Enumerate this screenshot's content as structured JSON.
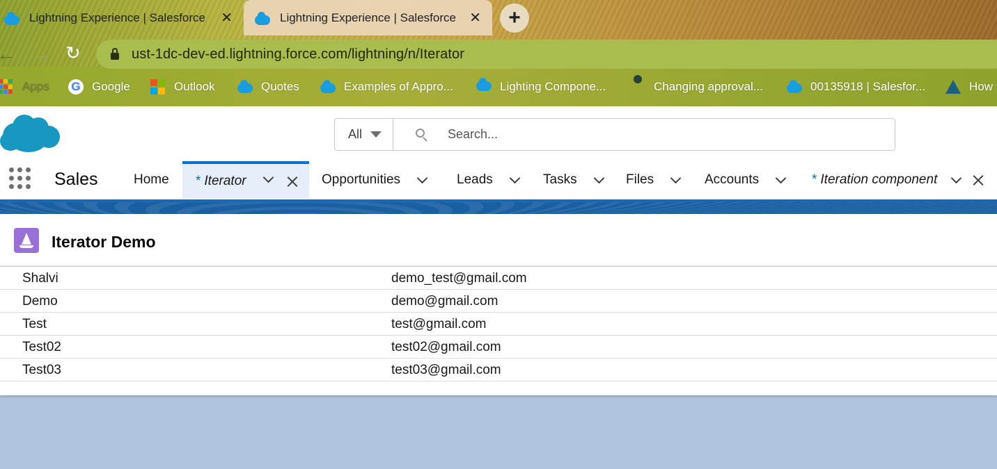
{
  "browser": {
    "tabs": [
      {
        "title": "Lightning Experience | Salesforce",
        "close": "✕"
      },
      {
        "title": "Lightning Experience | Salesforce",
        "close": "✕"
      }
    ],
    "new_tab": "+",
    "url": "ust-1dc-dev-ed.lightning.force.com/lightning/n/Iterator",
    "bookmarks": [
      {
        "label": "Apps",
        "icon": "apps-grid-icon"
      },
      {
        "label": "Google",
        "icon": "google-icon"
      },
      {
        "label": "Outlook",
        "icon": "microsoft-icon"
      },
      {
        "label": "Quotes",
        "icon": "salesforce-cloud-icon"
      },
      {
        "label": "Examples of Appro...",
        "icon": "salesforce-cloud-icon"
      },
      {
        "label": "Lighting Compone...",
        "icon": "salesforce-cloud-icon"
      },
      {
        "label": "Changing approval...",
        "icon": "dark-cloud-icon"
      },
      {
        "label": "00135918 | Salesfor...",
        "icon": "salesforce-cloud-icon"
      },
      {
        "label": "How",
        "icon": "trailhead-icon"
      }
    ]
  },
  "header": {
    "search_scope": "All",
    "search_placeholder": "Search..."
  },
  "nav": {
    "app_name": "Sales",
    "items": [
      {
        "label": "Home"
      },
      {
        "star": "*",
        "label": "Iterator",
        "active": true
      },
      {
        "label": "Opportunities"
      },
      {
        "label": "Leads"
      },
      {
        "label": "Tasks"
      },
      {
        "label": "Files"
      },
      {
        "label": "Accounts"
      },
      {
        "star": "*",
        "label": "Iteration component"
      }
    ]
  },
  "card": {
    "title": "Iterator Demo",
    "icon": "sailboat-icon",
    "rows": [
      {
        "name": "Shalvi",
        "email": "demo_test@gmail.com"
      },
      {
        "name": "Demo",
        "email": "demo@gmail.com"
      },
      {
        "name": "Test",
        "email": "test@gmail.com"
      },
      {
        "name": "Test02",
        "email": "test02@gmail.com"
      },
      {
        "name": "Test03",
        "email": "test03@gmail.com"
      }
    ]
  },
  "colors": {
    "brand_blue": "#0070d2",
    "salesforce_cloud": "#1798c1",
    "card_icon_purple": "#9a6fd8",
    "page_background": "#b0c4de"
  }
}
